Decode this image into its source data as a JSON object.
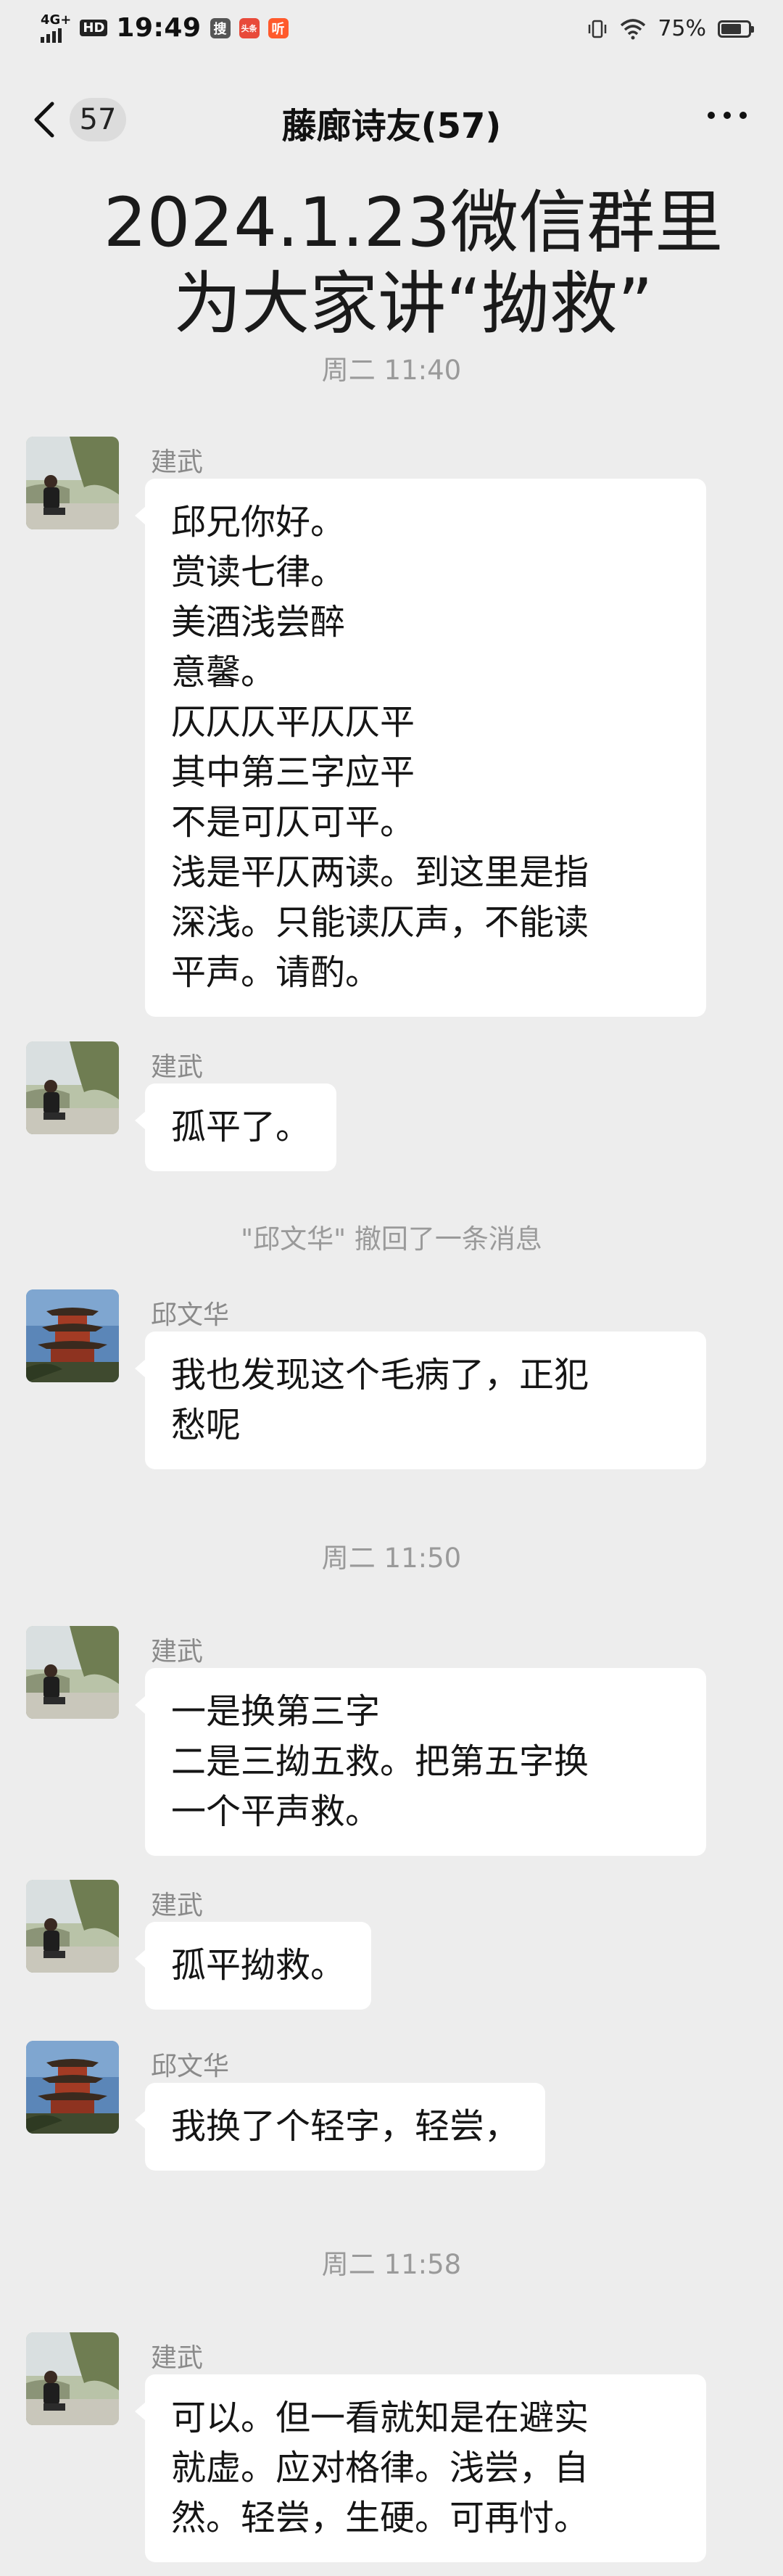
{
  "status_bar": {
    "network": "4G+",
    "hd": "HD",
    "time": "19:49",
    "app_icons": [
      "搜",
      "头条",
      "听"
    ],
    "battery_percent": "75%",
    "battery_level": 0.75,
    "icons": [
      "signal-icon",
      "vibrate-icon",
      "wifi-icon",
      "battery-icon"
    ]
  },
  "nav": {
    "back_count": "57",
    "title": "藤廊诗友(57)",
    "more_icon": "more-icon"
  },
  "caption": {
    "line1": "2024.1.23微信群里",
    "line2": "为大家讲“拗救”"
  },
  "timestamps": {
    "t1": "周二 11:40",
    "t2": "周二 11:50",
    "t3": "周二 11:58"
  },
  "notice": "\"邱文华\" 撤回了一条消息",
  "messages": [
    {
      "sender": "建武",
      "lines": [
        "邱兄你好。",
        "赏读七律。",
        "美酒浅尝醉",
        "意馨。",
        "仄仄仄平仄仄平",
        "其中第三字应平",
        "不是可仄可平。",
        "浅是平仄两读。到这里是指",
        "深浅。只能读仄声，不能读",
        "平声。请酌。"
      ]
    },
    {
      "sender": "建武",
      "lines": [
        "孤平了。"
      ]
    },
    {
      "sender": "邱文华",
      "lines": [
        "我也发现这个毛病了，正犯",
        "愁呢"
      ]
    },
    {
      "sender": "建武",
      "lines": [
        "一是换第三字",
        "二是三拗五救。把第五字换",
        "一个平声救。"
      ]
    },
    {
      "sender": "建武",
      "lines": [
        "孤平拗救。"
      ]
    },
    {
      "sender": "邱文华",
      "lines": [
        "我换了个轻字，轻尝，"
      ]
    },
    {
      "sender": "建武",
      "lines": [
        "可以。但一看就知是在避实",
        "就虚。应对格律。浅尝，自",
        "然。轻尝，生硬。可再忖。"
      ]
    }
  ],
  "colors": {
    "background": "#ededed",
    "bubble": "#ffffff",
    "meta_text": "#9a9a9a"
  }
}
